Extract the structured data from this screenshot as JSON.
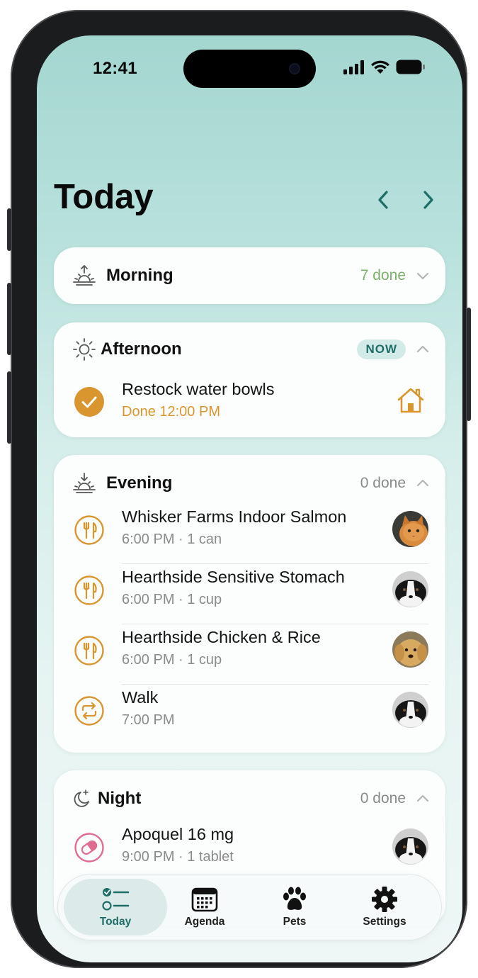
{
  "status_bar": {
    "time": "12:41"
  },
  "header": {
    "title": "Today"
  },
  "sections": {
    "morning": {
      "title": "Morning",
      "status": "7 done"
    },
    "afternoon": {
      "title": "Afternoon",
      "badge": "NOW",
      "items": [
        {
          "title": "Restock water bowls",
          "subtitle": "Done 12:00 PM",
          "icon": "home-icon"
        }
      ]
    },
    "evening": {
      "title": "Evening",
      "status": "0 done",
      "items": [
        {
          "title": "Whisker Farms Indoor Salmon",
          "subtitle": "6:00 PM · 1 can",
          "icon": "utensils-icon",
          "avatar": "orange-cat"
        },
        {
          "title": "Hearthside Sensitive Stomach",
          "subtitle": "6:00 PM · 1 cup",
          "icon": "utensils-icon",
          "avatar": "black-white-dog"
        },
        {
          "title": "Hearthside Chicken & Rice",
          "subtitle": "6:00 PM · 1 cup",
          "icon": "utensils-icon",
          "avatar": "golden-dog"
        },
        {
          "title": "Walk",
          "subtitle": "7:00 PM",
          "icon": "repeat-icon",
          "avatar": "black-white-dog"
        }
      ]
    },
    "night": {
      "title": "Night",
      "status": "0 done",
      "items": [
        {
          "title": "Apoquel 16 mg",
          "subtitle": "9:00 PM · 1 tablet",
          "icon": "pill-icon",
          "avatar": "black-white-dog"
        }
      ]
    }
  },
  "tabs": [
    {
      "label": "Today",
      "icon": "checklist-icon",
      "active": true
    },
    {
      "label": "Agenda",
      "icon": "calendar-icon",
      "active": false
    },
    {
      "label": "Pets",
      "icon": "paw-icon",
      "active": false
    },
    {
      "label": "Settings",
      "icon": "gear-icon",
      "active": false
    }
  ],
  "colors": {
    "accent": "#d9962f",
    "done_green": "#7bb36b",
    "teal": "#1f6d68",
    "pill_pink": "#e06c8f"
  }
}
